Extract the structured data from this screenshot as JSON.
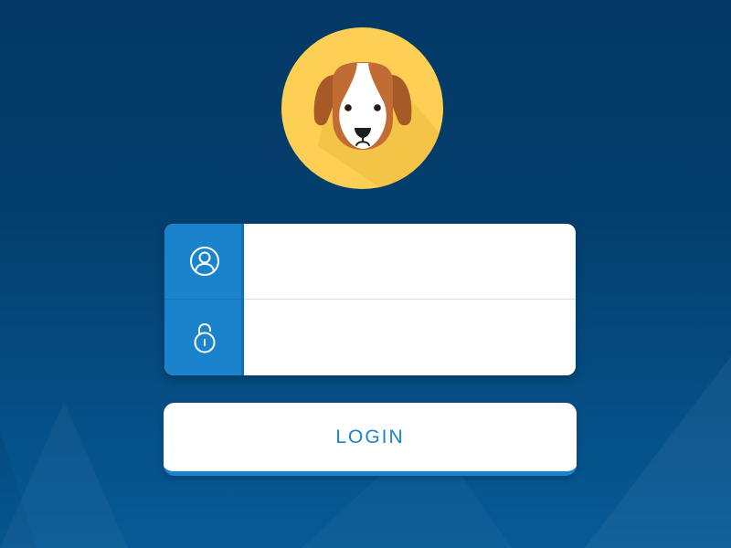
{
  "avatar": {
    "icon": "dog-face-icon",
    "circle_color": "#fdd055"
  },
  "form": {
    "username": {
      "icon": "user-icon",
      "value": "",
      "placeholder": ""
    },
    "password": {
      "icon": "padlock-icon",
      "value": "",
      "placeholder": ""
    }
  },
  "login_button": {
    "label": "LOGIN"
  },
  "colors": {
    "background": "#043f6e",
    "accent": "#1b83cc",
    "card": "#ffffff",
    "button_text": "#1b83cc"
  }
}
